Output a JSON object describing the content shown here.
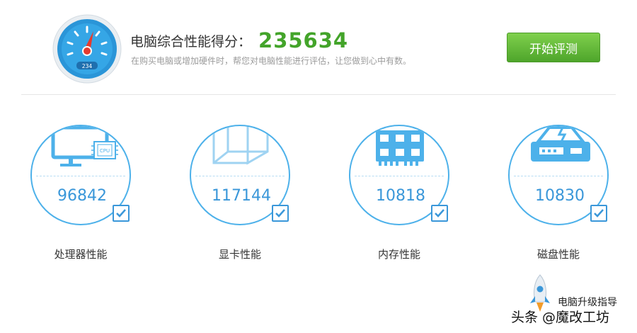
{
  "header": {
    "title_label": "电脑综合性能得分：",
    "total_score": "235634",
    "subtitle": "在购买电脑或增加硬件时，帮您对电脑性能进行评估，让您做到心中有数。",
    "start_button": "开始评测",
    "gauge_readout": "234",
    "gauge_icon": "speedometer-icon"
  },
  "cards": [
    {
      "label": "处理器性能",
      "score": "96842",
      "icon": "cpu-monitor-icon",
      "chip_text": "CPU"
    },
    {
      "label": "显卡性能",
      "score": "117144",
      "icon": "graphics-cube-icon"
    },
    {
      "label": "内存性能",
      "score": "10818",
      "icon": "memory-module-icon"
    },
    {
      "label": "磁盘性能",
      "score": "10830",
      "icon": "hard-disk-icon"
    }
  ],
  "floater": {
    "label": "电脑升级指导",
    "icon": "rocket-icon"
  },
  "watermark": "头条 @魔改工坊",
  "colors": {
    "accent_blue": "#3a97d9",
    "score_green": "#43a42a",
    "button_green": "#5cb335",
    "circle_border": "#4db1ea"
  }
}
